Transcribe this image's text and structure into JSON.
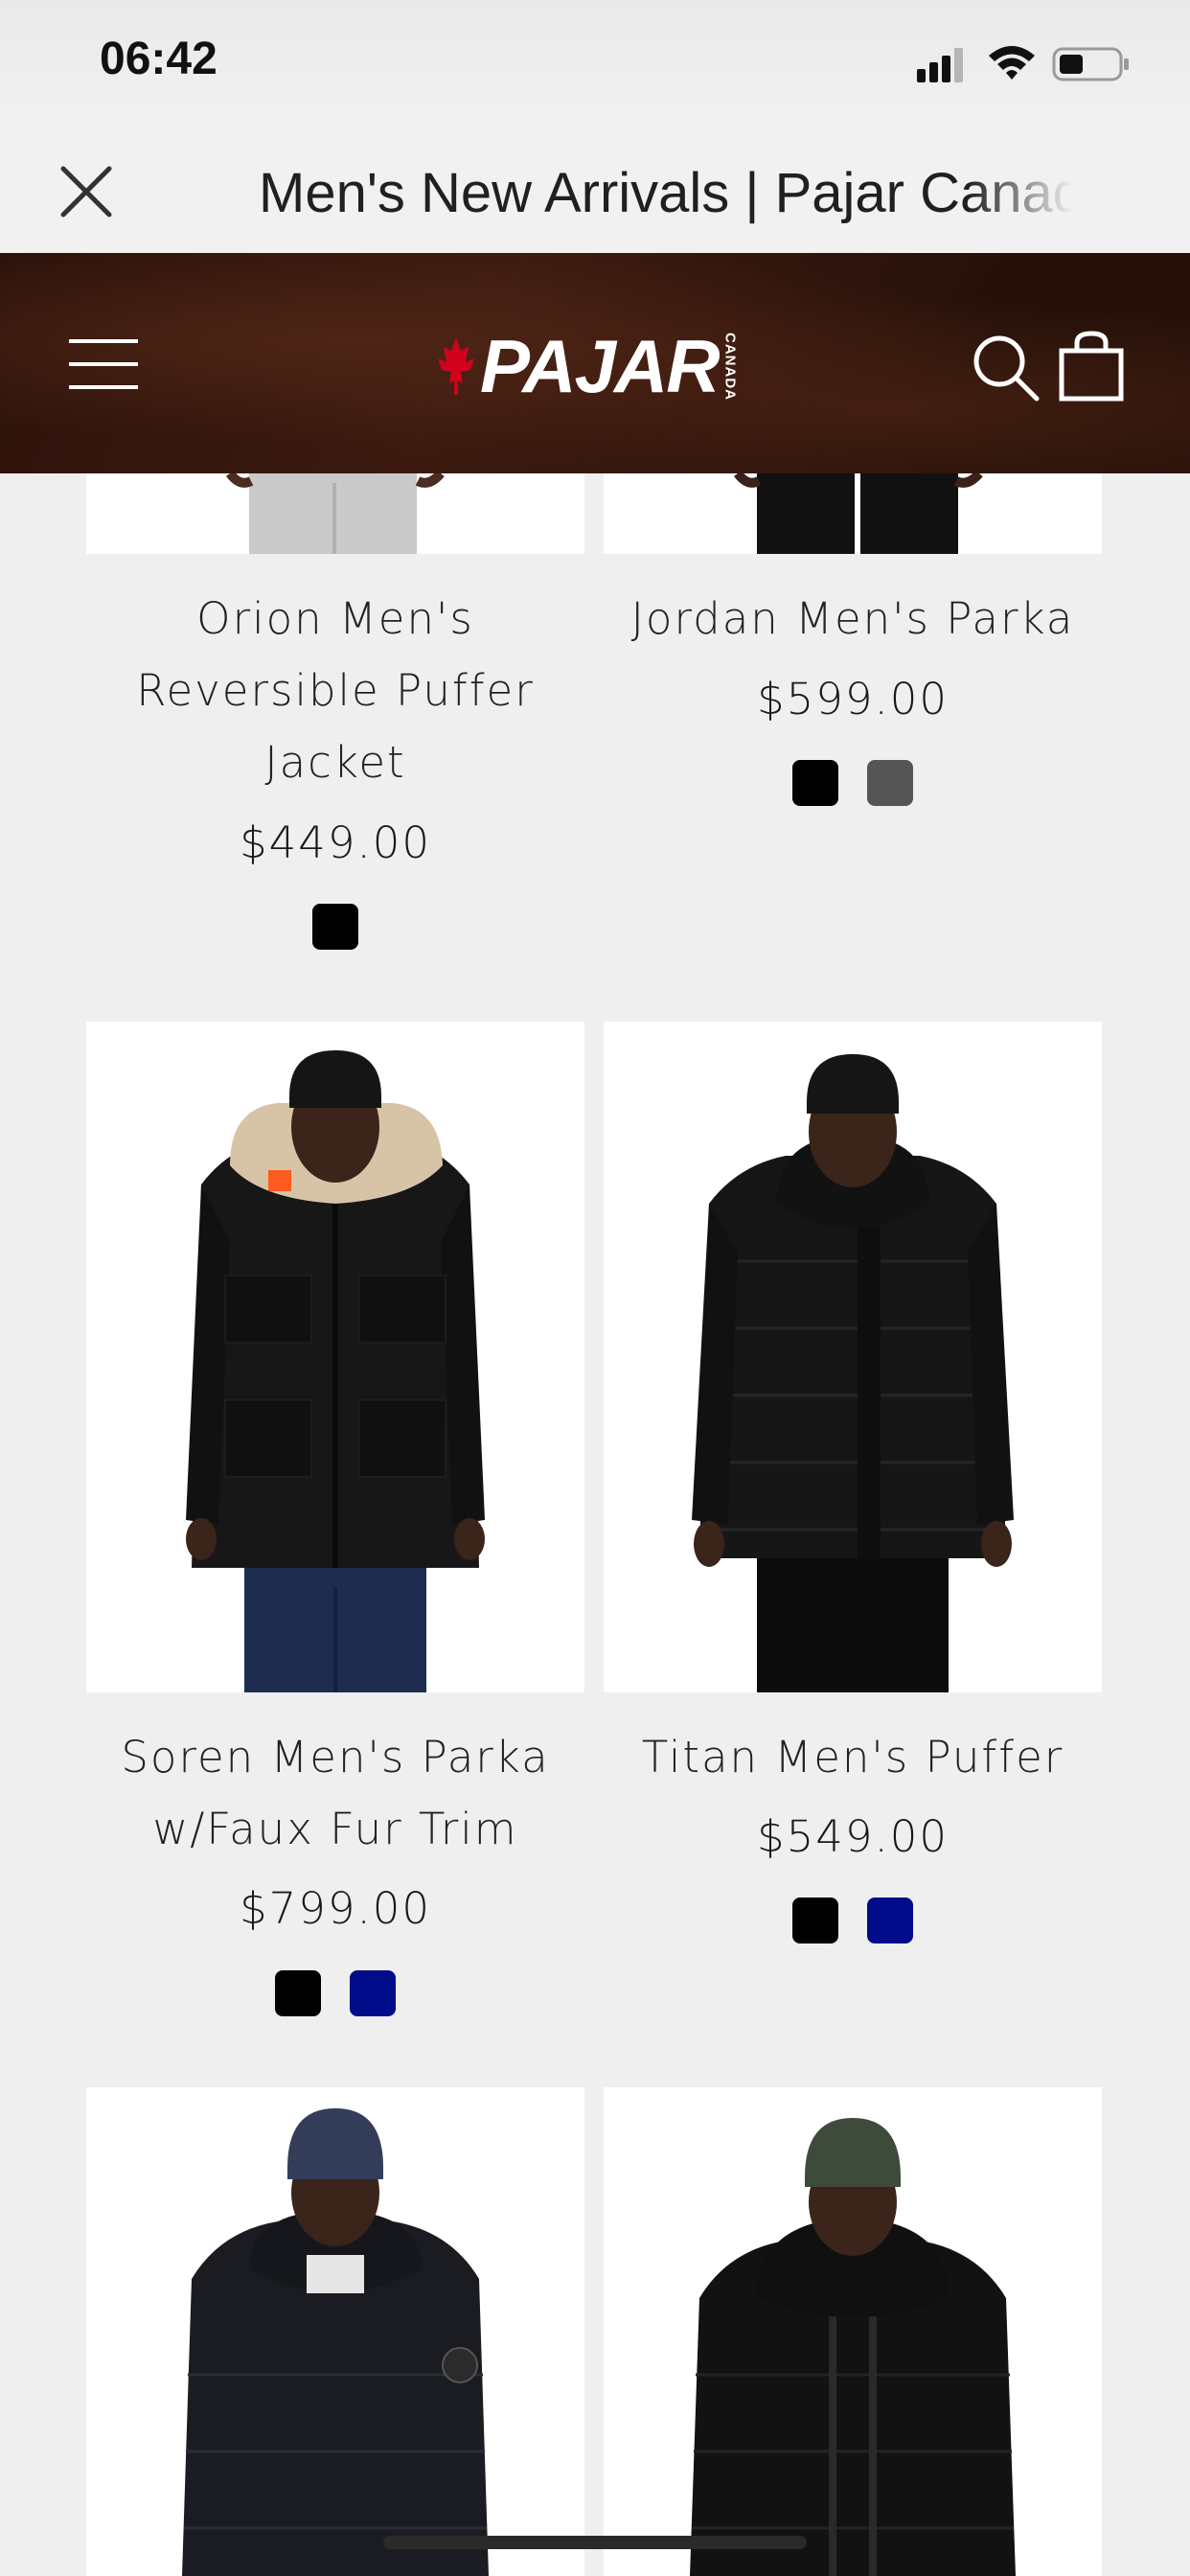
{
  "status_bar": {
    "time": "06:42"
  },
  "browser": {
    "title": "Men's New Arrivals | Pajar Canada"
  },
  "header": {
    "logo_text": "PAJAR",
    "logo_sub": "CANADA"
  },
  "products": [
    {
      "title": "Orion Men's Reversible Puffer Jacket",
      "price": "$449.00",
      "swatches": [
        "#000000"
      ]
    },
    {
      "title": "Jordan Men's Parka",
      "price": "$599.00",
      "swatches": [
        "#000000",
        "#555555"
      ]
    },
    {
      "title": "Soren Men's Parka w/Faux Fur Trim",
      "price": "$799.00",
      "swatches": [
        "#000000",
        "#000c8a"
      ]
    },
    {
      "title": "Titan Men's Puffer",
      "price": "$549.00",
      "swatches": [
        "#000000",
        "#000c8a"
      ]
    }
  ],
  "colors": {
    "header_brown": "#2c120b",
    "navy": "#000c8a"
  }
}
